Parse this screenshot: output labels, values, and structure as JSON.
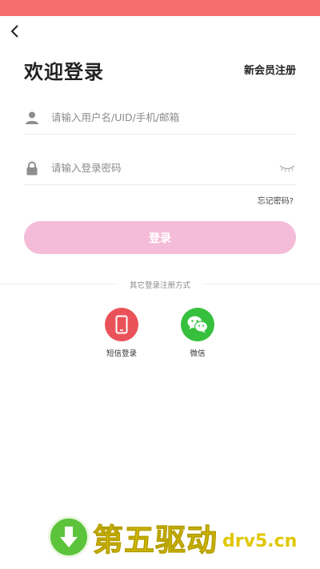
{
  "header": {
    "title": "欢迎登录",
    "register_label": "新会员注册"
  },
  "form": {
    "username_placeholder": "请输入用户名/UID/手机/邮箱",
    "password_placeholder": "请输入登录密码",
    "forgot_label": "忘记密码?",
    "login_label": "登录"
  },
  "other_login": {
    "divider_text": "其它登录注册方式",
    "options": [
      {
        "label": "短信登录",
        "icon": "phone-icon",
        "color": "#ea525a"
      },
      {
        "label": "微信",
        "icon": "wechat-icon",
        "color": "#36c03d"
      }
    ]
  },
  "watermark": {
    "brand": "第五驱动",
    "url": "drv5.cn"
  },
  "colors": {
    "status_bar": "#f86e70",
    "login_button": "#f4bcd8"
  }
}
